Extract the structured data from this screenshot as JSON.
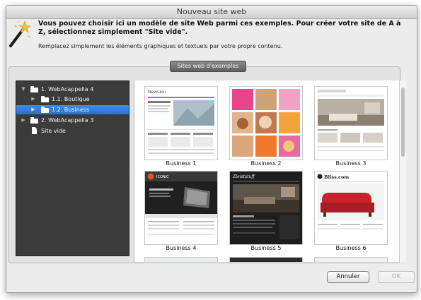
{
  "window": {
    "title": "Nouveau site web"
  },
  "header": {
    "headline": "Vous pouvez choisir ici un modèle de site Web parmi ces exemples. Pour créer votre site de A à Z, sélectionnez simplement \"Site vide\".",
    "subline": "Remplacez simplement les éléments graphiques et textuels par votre propre contenu.",
    "icon": "magic-wand-icon"
  },
  "section_tab": {
    "label": "Sites web d'exemples"
  },
  "sidebar": {
    "items": [
      {
        "label": "1. WebAcappella 4",
        "expanded": true,
        "icon": "folder-icon",
        "selected": false
      },
      {
        "label": "1.1. Boutique",
        "expanded": false,
        "icon": "folder-icon",
        "selected": false
      },
      {
        "label": "1.2. Business",
        "expanded": false,
        "icon": "folder-icon",
        "selected": true
      },
      {
        "label": "2. WebAcappella 3",
        "expanded": false,
        "icon": "folder-icon",
        "selected": false
      },
      {
        "label": "Site vide",
        "icon": "page-icon",
        "selected": false
      }
    ]
  },
  "templates": [
    {
      "label": "Business  1",
      "thumb_header": "NewLexi"
    },
    {
      "label": "Business  2",
      "thumb_header": ""
    },
    {
      "label": "Business  3",
      "thumb_header": ""
    },
    {
      "label": "Business  4",
      "thumb_header": "ICONIC"
    },
    {
      "label": "Business  5",
      "thumb_header": "Zleiststuff"
    },
    {
      "label": "Business  6",
      "thumb_header": "Bliss.com"
    }
  ],
  "buttons": {
    "cancel": "Annuler",
    "ok": "OK"
  },
  "colors": {
    "selection": "#3a86e6",
    "sidebar_bg": "#3b3b3b",
    "window_bg": "#ececec"
  }
}
